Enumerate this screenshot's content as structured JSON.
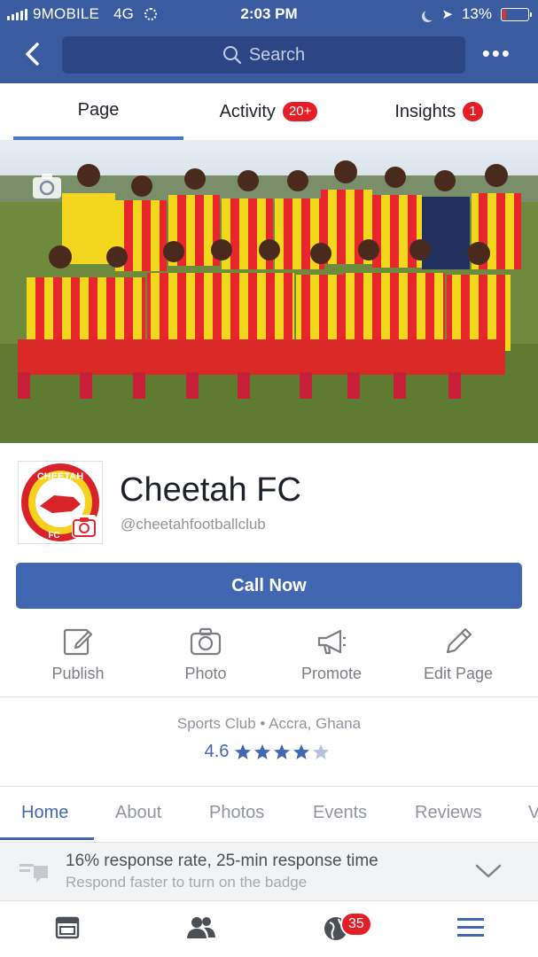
{
  "status_bar": {
    "carrier": "9MOBILE",
    "network": "4G",
    "time": "2:03 PM",
    "battery": "13%"
  },
  "nav": {
    "search_placeholder": "Search",
    "back_icon": "chevron-left-icon",
    "more_icon": "more-dots-icon"
  },
  "tabs": [
    {
      "label": "Page",
      "badge": ""
    },
    {
      "label": "Activity",
      "badge": "20+"
    },
    {
      "label": "Insights",
      "badge": "1"
    }
  ],
  "page": {
    "name": "Cheetah FC",
    "handle": "@cheetahfootballclub",
    "logo_text_top": "CHEETAH",
    "logo_text_bottom": "FC",
    "cta": "Call Now"
  },
  "actions": [
    {
      "label": "Publish",
      "icon": "pencil-square-icon"
    },
    {
      "label": "Photo",
      "icon": "camera-icon"
    },
    {
      "label": "Promote",
      "icon": "megaphone-icon"
    },
    {
      "label": "Edit Page",
      "icon": "pencil-icon"
    }
  ],
  "info": {
    "category_line": "Sports Club • Accra, Ghana",
    "rating": "4.6",
    "rating_value": 4.6
  },
  "section_tabs": [
    "Home",
    "About",
    "Photos",
    "Events",
    "Reviews",
    "V"
  ],
  "response": {
    "line1": "16% response rate, 25-min response time",
    "line2": "Respond faster to turn on the badge"
  },
  "bottom_nav": {
    "notifications_badge": "35"
  },
  "colors": {
    "brand": "#3b5ba0",
    "button": "#4267b2",
    "badge": "#e41e26"
  }
}
